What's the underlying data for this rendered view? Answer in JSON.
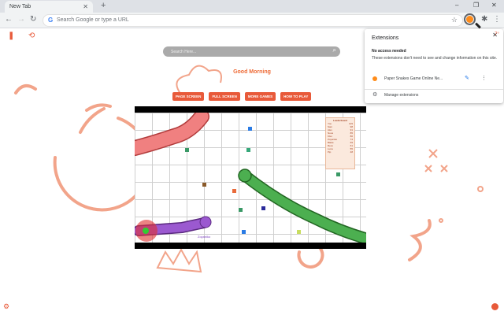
{
  "browser": {
    "tab_title": "New Tab",
    "tab_close": "✕",
    "new_tab": "+",
    "omnibox_placeholder": "Search Google or type a URL",
    "win_min": "–",
    "win_max": "❐",
    "win_close": "✕"
  },
  "newtab": {
    "search_placeholder": "Search Here...",
    "greeting": "Good Morning",
    "buttons": [
      "PAGE SCREEN",
      "FULL SCREEN",
      "MORE GAMES",
      "HOW TO PLAY"
    ],
    "badge_temp": "7°"
  },
  "game": {
    "leaderboard_title": "Leaderboard",
    "leaderboard": [
      {
        "name": "You",
        "score": "129"
      },
      {
        "name": "Sam",
        "score": "98"
      },
      {
        "name": "Alex",
        "score": "91"
      },
      {
        "name": "Nova",
        "score": "85"
      },
      {
        "name": "Kiwi",
        "score": "80"
      },
      {
        "name": "Zoyaniko",
        "score": "74"
      },
      {
        "name": "Blade",
        "score": "69"
      },
      {
        "name": "Rexo",
        "score": "61"
      },
      {
        "name": "Luna",
        "score": "55"
      },
      {
        "name": "Pip",
        "score": "48"
      }
    ],
    "player_label": "Zoyaniko"
  },
  "extensions_panel": {
    "title": "Extensions",
    "close": "✕",
    "heading": "No access needed",
    "description": "These extensions don't need to see and change information on this site.",
    "item_name": "Paper Snakes Game Online Ne...",
    "manage": "Manage extensions"
  },
  "icons": [
    "bookmark-icon",
    "history-icon",
    "search-icon",
    "gear-icon",
    "puzzle-icon",
    "pin-icon",
    "more-icon"
  ],
  "colors": {
    "accent": "#e85a3a",
    "snake_red": "#f08080",
    "snake_green": "#4caf50",
    "snake_purple": "#9b59d0"
  }
}
